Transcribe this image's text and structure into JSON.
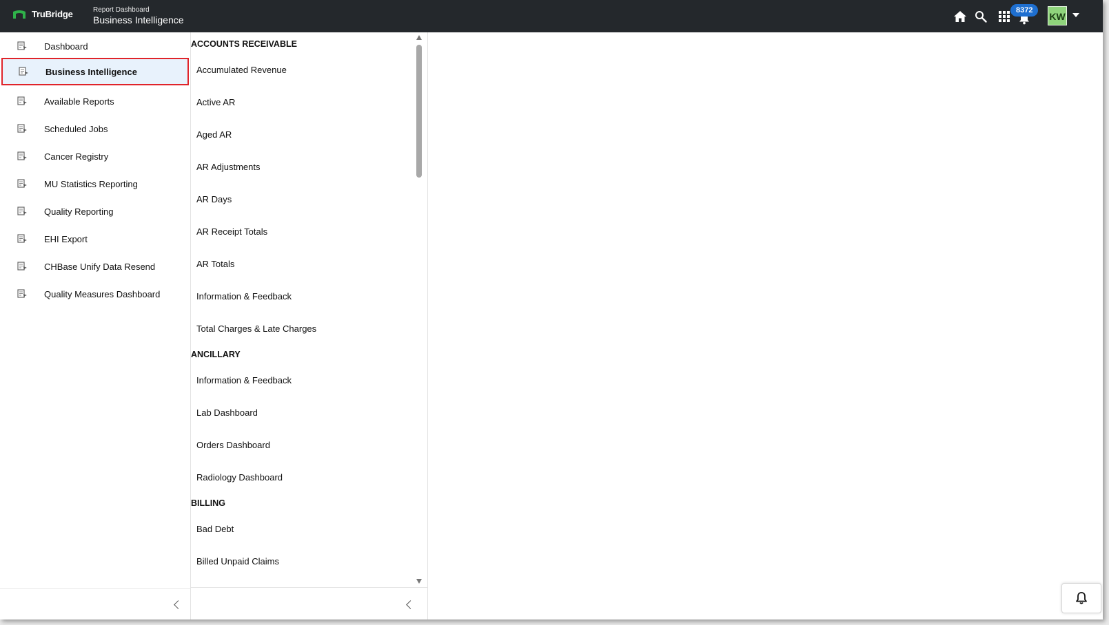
{
  "topbar": {
    "brand": "TruBridge",
    "breadcrumb_parent": "Report Dashboard",
    "breadcrumb_current": "Business Intelligence",
    "icons": [
      "home-icon",
      "search-icon",
      "apps-grid-icon",
      "bell-icon"
    ],
    "notification_count": "8372",
    "user_initials": "KW",
    "accent_color": "#1e6fd0",
    "avatar_color": "#8fd47c"
  },
  "sidebar": {
    "items": [
      {
        "label": "Dashboard"
      },
      {
        "label": "Business Intelligence",
        "active": true
      },
      {
        "label": "Available Reports"
      },
      {
        "label": "Scheduled Jobs"
      },
      {
        "label": "Cancer Registry"
      },
      {
        "label": "MU Statistics Reporting"
      },
      {
        "label": "Quality Reporting"
      },
      {
        "label": "EHI Export"
      },
      {
        "label": "CHBase Unify Data Resend"
      },
      {
        "label": "Quality Measures Dashboard"
      }
    ],
    "highlight_color": "#e0242a"
  },
  "reports": {
    "sections": [
      {
        "title": "ACCOUNTS RECEIVABLE",
        "items": [
          "Accumulated Revenue",
          "Active AR",
          "Aged AR",
          "AR Adjustments",
          "AR Days",
          "AR Receipt Totals",
          "AR Totals",
          "Information & Feedback",
          "Total Charges & Late Charges"
        ]
      },
      {
        "title": "ANCILLARY",
        "items": [
          "Information & Feedback",
          "Lab Dashboard",
          "Orders Dashboard",
          "Radiology Dashboard"
        ]
      },
      {
        "title": "BILLING",
        "items": [
          "Bad Debt",
          "Billed Unpaid Claims"
        ]
      }
    ]
  }
}
